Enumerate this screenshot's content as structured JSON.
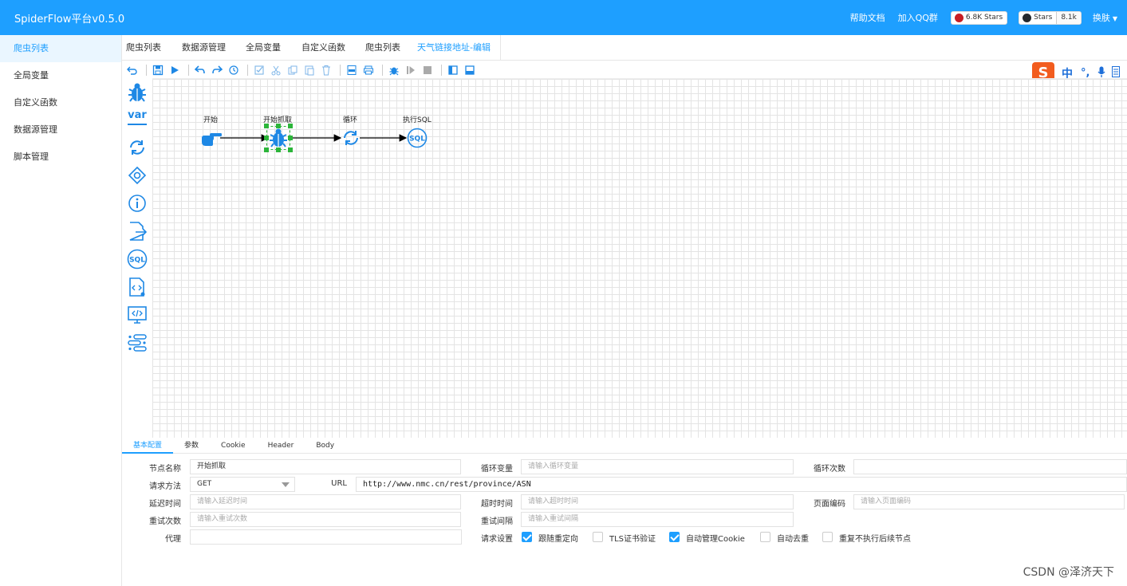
{
  "header": {
    "title": "SpiderFlow平台v0.5.0",
    "help": "帮助文档",
    "qq": "加入QQ群",
    "gitee_stars": "6.8K Stars",
    "github_label": "Stars",
    "github_count": "8.1k",
    "skin": "换肤"
  },
  "sidebar": {
    "items": [
      "爬虫列表",
      "全局变量",
      "自定义函数",
      "数据源管理",
      "脚本管理"
    ]
  },
  "tabs": [
    "爬虫列表",
    "数据源管理",
    "全局变量",
    "自定义函数",
    "爬虫列表",
    "天气链接地址-编辑"
  ],
  "palette": {
    "var_label": "var"
  },
  "flow": {
    "nodes": [
      "开始",
      "开始抓取",
      "循环",
      "执行SQL"
    ]
  },
  "ime": {
    "mode": "中"
  },
  "panel": {
    "tabs": [
      "基本配置",
      "参数",
      "Cookie",
      "Header",
      "Body"
    ],
    "labels": {
      "node_name": "节点名称",
      "loop_var": "循环变量",
      "loop_count": "循环次数",
      "method": "请求方法",
      "url": "URL",
      "delay": "延迟时间",
      "timeout": "超时时间",
      "encoding": "页面编码",
      "retry_count": "重试次数",
      "retry_interval": "重试间隔",
      "proxy": "代理",
      "settings": "请求设置"
    },
    "values": {
      "node_name": "开始抓取",
      "method": "GET",
      "url": "http://www.nmc.cn/rest/province/ASN"
    },
    "placeholders": {
      "loop_var": "请输入循环变量",
      "delay": "请输入延迟时间",
      "timeout": "请输入超时时间",
      "encoding": "请输入页面编码",
      "retry_count": "请输入重试次数",
      "retry_interval": "请输入重试间隔"
    },
    "checkboxes": [
      {
        "label": "跟随重定向",
        "checked": true
      },
      {
        "label": "TLS证书验证",
        "checked": false
      },
      {
        "label": "自动管理Cookie",
        "checked": true
      },
      {
        "label": "自动去重",
        "checked": false
      },
      {
        "label": "重复不执行后续节点",
        "checked": false
      }
    ]
  },
  "watermark": "CSDN @泽济天下",
  "colors": {
    "primary": "#1e9fff",
    "icon": "#1e88e5",
    "ime": "#f25c1e"
  }
}
